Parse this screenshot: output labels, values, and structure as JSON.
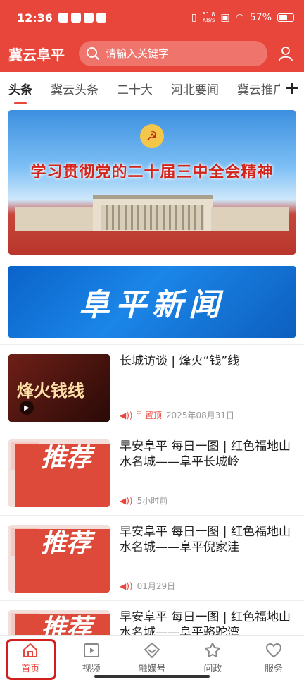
{
  "status": {
    "time": "12:36",
    "speed_value": "51.8",
    "speed_unit": "KB/s",
    "battery": "57%"
  },
  "header": {
    "app_name": "冀云阜平",
    "search_placeholder": "请输入关键字"
  },
  "tabs": [
    "头条",
    "冀云头条",
    "二十大",
    "河北要闻",
    "冀云推广"
  ],
  "banners": {
    "top_text": "学习贯彻党的二十届三中全会精神",
    "news_text": "阜平新闻"
  },
  "articles": [
    {
      "title": "长城访谈 | 烽火“钱”线",
      "thumb_text": "烽火钱线",
      "pinned_label": "置顶",
      "date": "2025年08月31日"
    },
    {
      "title": "早安阜平 每日一图 | 红色福地山水名城——阜平长城岭",
      "thumb_text": "推荐",
      "date": "5小时前"
    },
    {
      "title": "早安阜平 每日一图 | 红色福地山水名城——阜平倪家洼",
      "thumb_text": "推荐",
      "date": "01月29日"
    },
    {
      "title": "早安阜平 每日一图 | 红色福地山水名城——阜平骆驼湾",
      "thumb_text": "推荐",
      "date": ""
    }
  ],
  "bottom_nav": [
    "首页",
    "视频",
    "融媒号",
    "问政",
    "服务"
  ],
  "colors": {
    "brand_red": "#e8463b"
  }
}
